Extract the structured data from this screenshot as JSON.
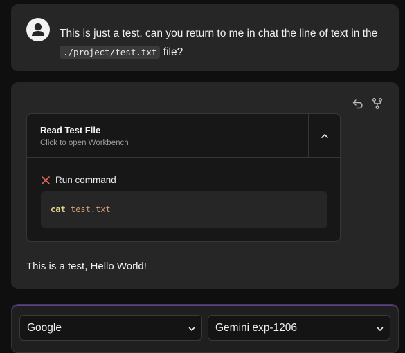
{
  "user_message": {
    "text_before": "This is just a test, can you return to me in chat the line of text in the",
    "code": "./project/test.txt",
    "text_after": "file?"
  },
  "assistant_message": {
    "artifact": {
      "title": "Read Test File",
      "subtitle": "Click to open Workbench",
      "step_label": "Run command",
      "command": "cat",
      "argument": "test.txt"
    },
    "result_text": "This is a test, Hello World!"
  },
  "composer": {
    "provider_select": "Google",
    "model_select": "Gemini exp-1206"
  },
  "colors": {
    "background": "#0f0f0f",
    "card": "#262626",
    "error_icon": "#e5645c",
    "command_keyword": "#e0d38a",
    "command_arg": "#d79e77"
  },
  "icons": [
    "user-avatar-icon",
    "undo-icon",
    "fork-icon",
    "chevron-up-icon",
    "x-icon",
    "chevron-down-icon"
  ]
}
